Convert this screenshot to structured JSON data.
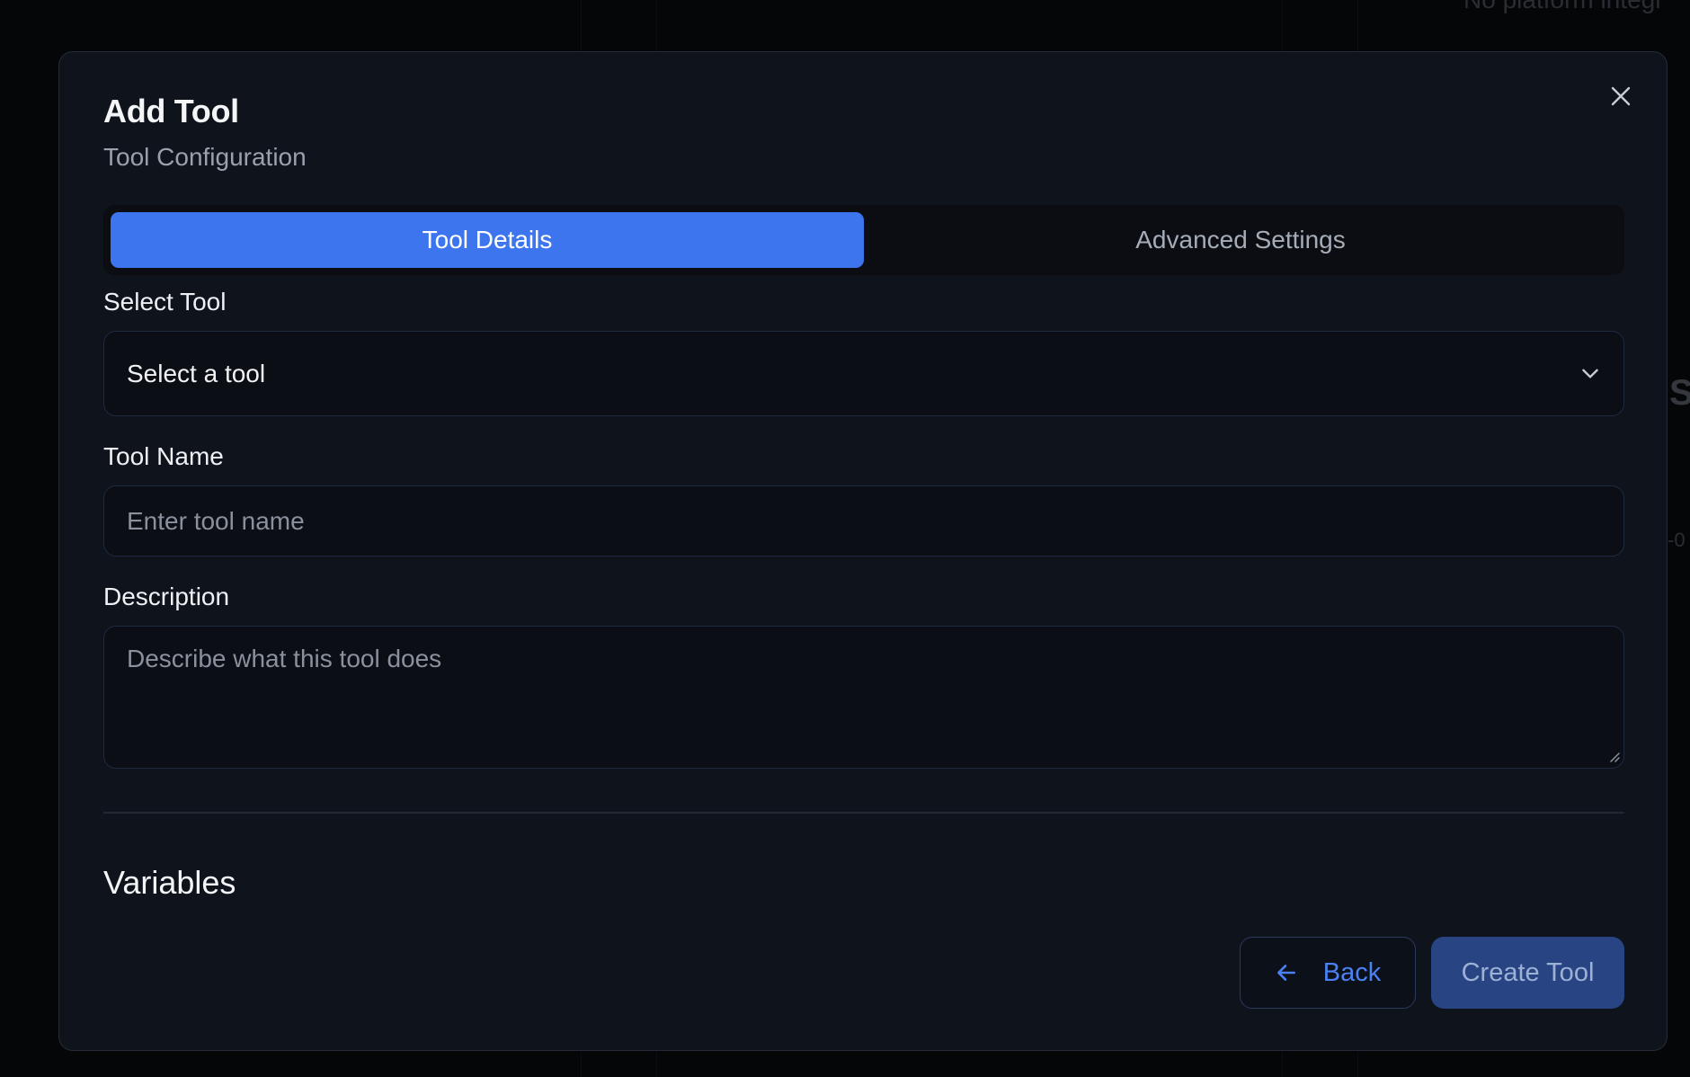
{
  "background": {
    "text_top_right": "No platform integr",
    "text_edge_1": "S",
    "text_edge_2": "-0"
  },
  "modal": {
    "title": "Add Tool",
    "subtitle": "Tool Configuration",
    "close_icon": "close-icon"
  },
  "tabs": [
    {
      "label": "Tool Details",
      "active": true
    },
    {
      "label": "Advanced Settings",
      "active": false
    }
  ],
  "fields": {
    "select_tool": {
      "label": "Select Tool",
      "value": "Select a tool",
      "icon": "chevron-down-icon"
    },
    "tool_name": {
      "label": "Tool Name",
      "value": "",
      "placeholder": "Enter tool name"
    },
    "description": {
      "label": "Description",
      "value": "",
      "placeholder": "Describe what this tool does"
    }
  },
  "variables": {
    "title": "Variables"
  },
  "buttons": {
    "back_label": "Back",
    "back_icon": "arrow-left-icon",
    "create_label": "Create Tool"
  },
  "colors": {
    "accent": "#3d75ee",
    "modal_bg": "#0f131c",
    "create_button_bg": "#284483"
  }
}
